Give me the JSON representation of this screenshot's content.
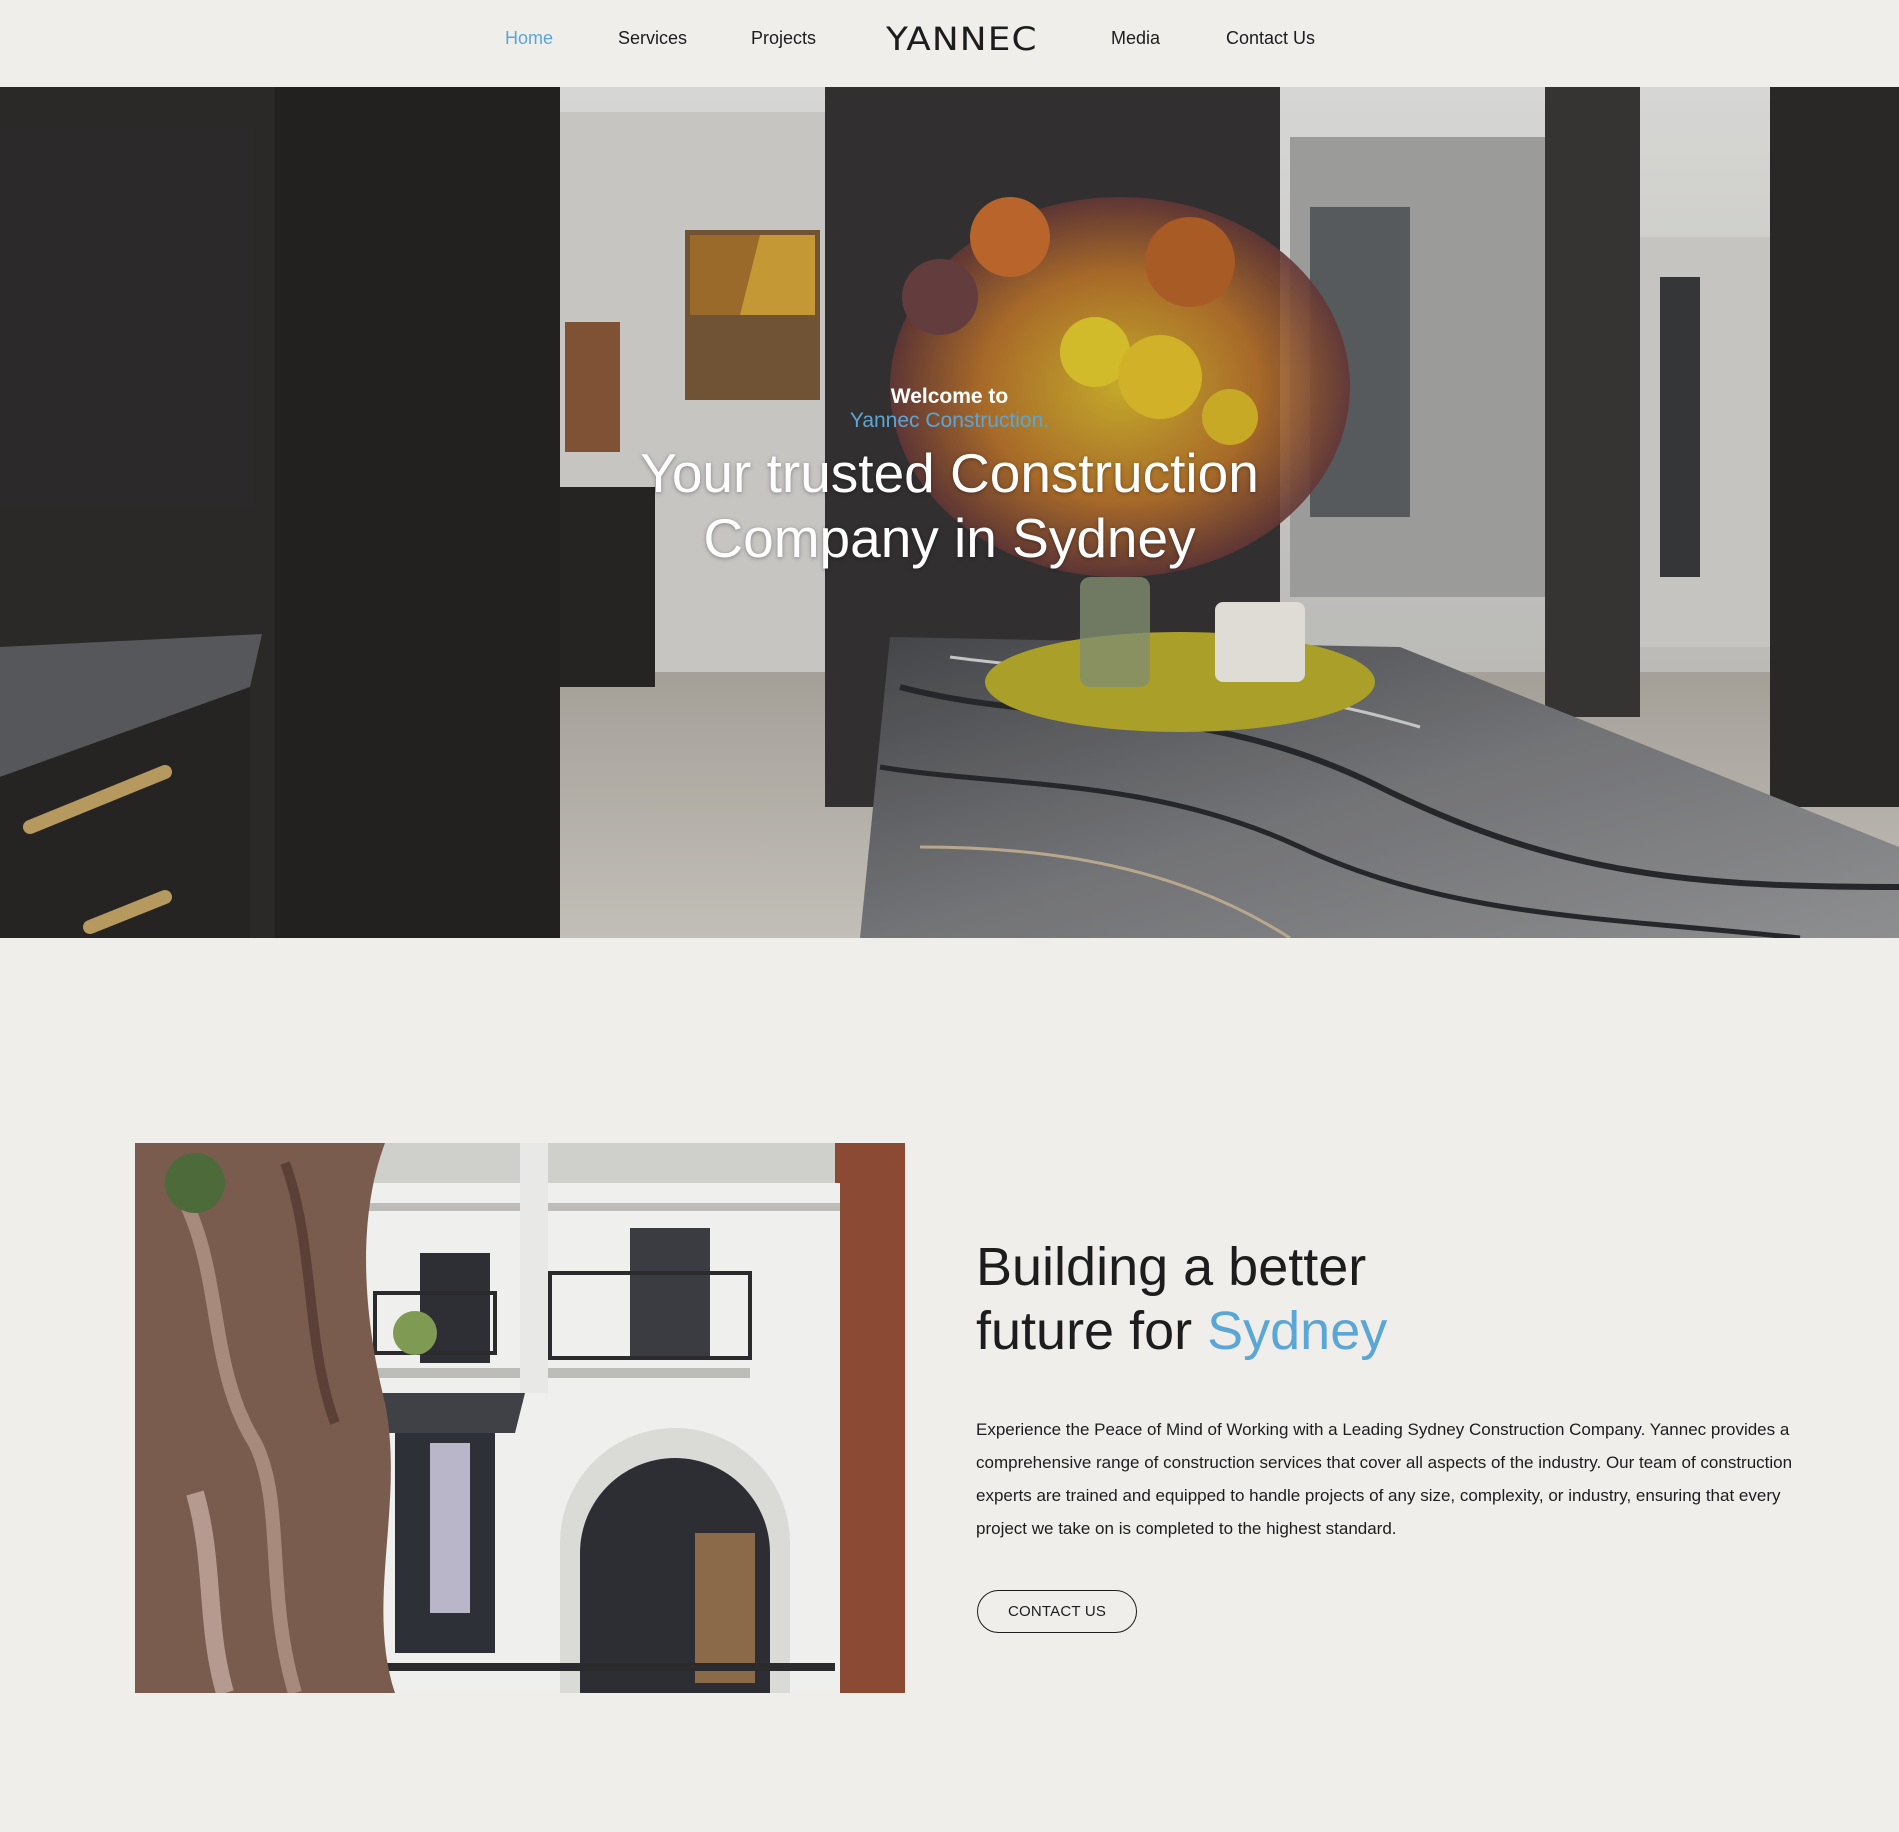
{
  "nav": {
    "items": [
      {
        "label": "Home",
        "active": true
      },
      {
        "label": "Services"
      },
      {
        "label": "Projects"
      },
      {
        "label": "Media"
      },
      {
        "label": "Contact Us"
      }
    ],
    "logo": "YANNEC"
  },
  "hero": {
    "welcome": "Welcome to",
    "brand": "Yannec Construction.",
    "title_line1": "Your trusted Construction",
    "title_line2": "Company in Sydney",
    "image": "kitchen-interior-photo"
  },
  "about": {
    "heading_line1": "Building a better",
    "heading_line2_prefix": "future for ",
    "heading_accent": "Sydney",
    "body": "Experience the Peace of Mind of Working with a Leading Sydney Construction Company. Yannec provides a comprehensive range of construction services that cover all aspects of the industry. Our team of construction experts are trained and equipped to handle projects of any size, complexity, or industry, ensuring that every project we take on is completed to the highest standard.",
    "cta_label": "CONTACT US",
    "image": "terrace-house-photo"
  },
  "colors": {
    "background": "#efeeeb",
    "accent": "#5aa6d6",
    "text": "#1d1d1d"
  }
}
